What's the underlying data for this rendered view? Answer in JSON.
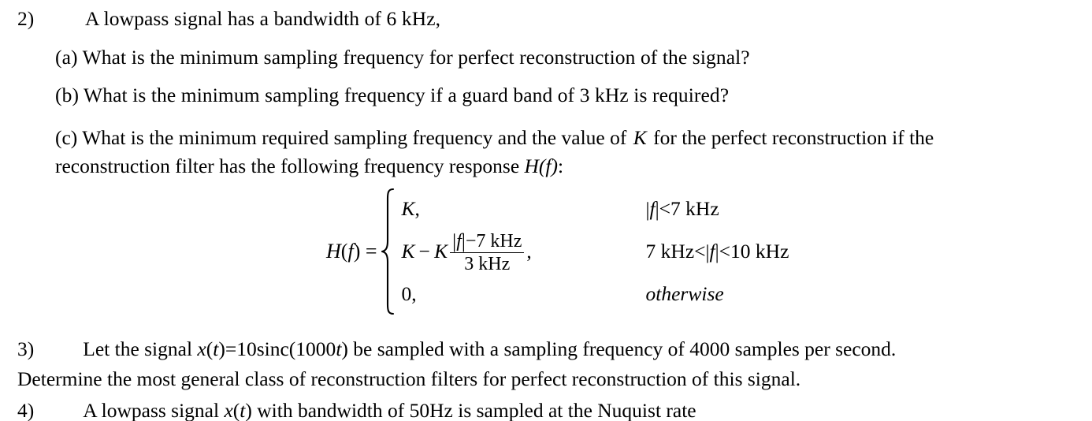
{
  "document": {
    "background_color": "#ffffff",
    "text_color": "#000000"
  },
  "question2": {
    "number": "2)",
    "stem": "A lowpass signal has a bandwidth of 6 kHz,",
    "items": [
      {
        "label": "(a)",
        "text": "(a) What is the minimum sampling frequency for perfect reconstruction of the signal?"
      },
      {
        "label": "(b)",
        "text": "(b) What is the minimum sampling frequency if a guard band of 3 kHz is required?"
      },
      {
        "label": "(c)",
        "line1_part1": "(c) What is the minimum required sampling frequency and the value of ",
        "line1_var": "K",
        "line1_part2": " for the perfect reconstruction if the",
        "line2_part1": "reconstruction filter has the following frequency response ",
        "line2_var": "H(f)",
        "line2_part2": ":"
      }
    ],
    "equation": {
      "lhs": "H(f) =",
      "lhs_func": "H",
      "lhs_open": "(",
      "lhs_arg": "f",
      "lhs_close": ")",
      "lhs_equals": "=",
      "cases": [
        {
          "value_plain": "K,",
          "value_var": "K",
          "value_comma": ",",
          "condition": "|f| < 7 kHz",
          "cond_bar_left": "|",
          "cond_var": "f",
          "cond_bar_right": "|",
          "cond_rel": "<",
          "cond_rhs": "7 kHz",
          "italic_condition": false
        },
        {
          "value_plain": "K − K (|f| − 7 kHz) / (3 kHz),",
          "value_var1": "K",
          "value_minus": "−",
          "value_var2": "K",
          "numerator_bar_left": "|",
          "numerator_var": "f",
          "numerator_bar_right": "|",
          "numerator_minus": "−",
          "numerator_rest": "7 kHz",
          "denominator": "3 kHz",
          "trailing_comma": ",",
          "condition": "7 kHz < |f| < 10 kHz",
          "cond_lhs": "7 kHz",
          "cond_rel1": "<",
          "cond_bar_left": "|",
          "cond_var": "f",
          "cond_bar_right": "|",
          "cond_rel2": "<",
          "cond_rhs": "10 kHz",
          "italic_condition": false
        },
        {
          "value_plain": "0,",
          "condition": "otherwise",
          "italic_condition": true
        }
      ]
    }
  },
  "question3": {
    "number": "3)",
    "line1_pre": "Let  the  signal  ",
    "expr_x": "x",
    "expr_open": "(",
    "expr_t": "t",
    "expr_close": ")",
    "expr_equals": "=",
    "expr_rhs_pre": "10sinc(1000",
    "expr_rhs_t": "t",
    "expr_rhs_post": ")",
    "line1_post": " be  sampled  with  a  sampling  frequency  of  4000  samples  per  second.",
    "line2": "Determine the most general class of reconstruction filters for perfect reconstruction of this signal."
  },
  "question4": {
    "number": "4)",
    "text_pre": "A  lowpass  signal  ",
    "expr_x": "x",
    "expr_open": "(",
    "expr_t": "t",
    "expr_close": ")",
    "text_post": " with  bandwidth  of  50Hz  is  sampled  at  the  Nuquist  rate"
  }
}
